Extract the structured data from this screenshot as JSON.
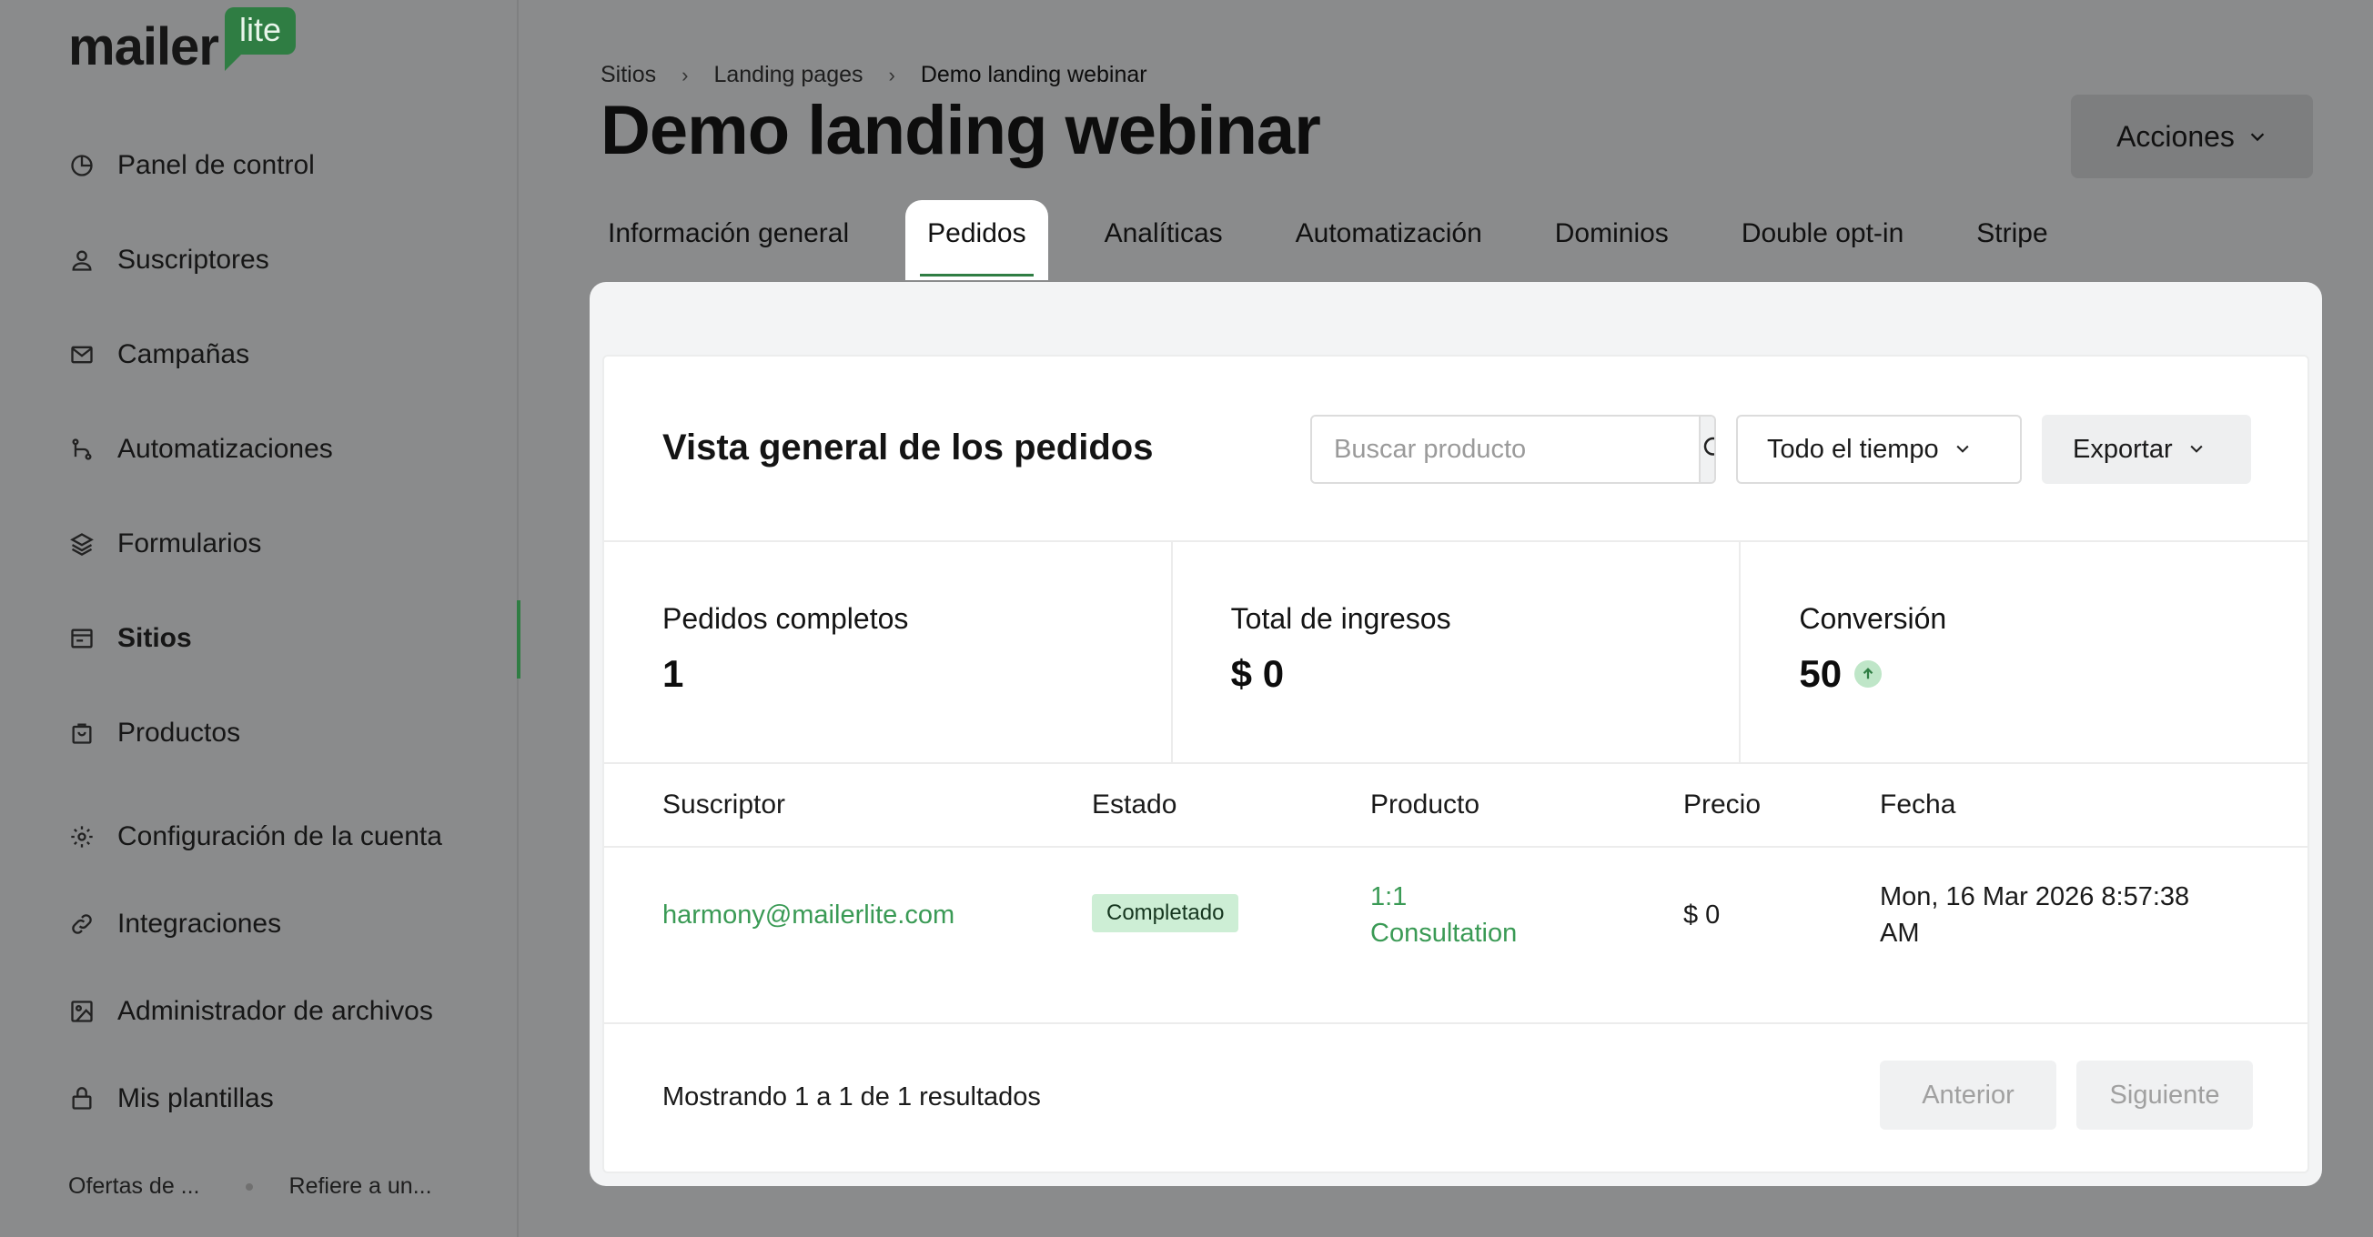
{
  "app": {
    "logo_word": "mailer",
    "logo_badge": "lite"
  },
  "sidebar": {
    "items": [
      {
        "label": "Panel de control",
        "icon": "clock-icon"
      },
      {
        "label": "Suscriptores",
        "icon": "user-icon"
      },
      {
        "label": "Campañas",
        "icon": "mail-icon"
      },
      {
        "label": "Automatizaciones",
        "icon": "workflow-icon"
      },
      {
        "label": "Formularios",
        "icon": "layers-icon"
      },
      {
        "label": "Sitios",
        "icon": "browser-icon",
        "active": true
      },
      {
        "label": "Productos",
        "icon": "bag-icon"
      }
    ],
    "secondary": [
      {
        "label": "Configuración de la cuenta",
        "icon": "gear-icon"
      },
      {
        "label": "Integraciones",
        "icon": "link-icon"
      },
      {
        "label": "Administrador de archivos",
        "icon": "image-icon"
      },
      {
        "label": "Mis plantillas",
        "icon": "template-icon"
      }
    ],
    "footer": {
      "left": "Ofertas de ...",
      "right": "Refiere a un..."
    }
  },
  "breadcrumb": {
    "items": [
      "Sitios",
      "Landing pages"
    ],
    "current": "Demo landing webinar"
  },
  "page": {
    "title": "Demo landing webinar",
    "actions_label": "Acciones"
  },
  "tabs": [
    {
      "label": "Información general"
    },
    {
      "label": "Pedidos",
      "active": true
    },
    {
      "label": "Analíticas"
    },
    {
      "label": "Automatización"
    },
    {
      "label": "Dominios"
    },
    {
      "label": "Double opt-in"
    },
    {
      "label": "Stripe"
    }
  ],
  "orders": {
    "title": "Vista general de los pedidos",
    "search": {
      "placeholder": "Buscar producto",
      "value": ""
    },
    "period": "Todo el tiempo",
    "export_label": "Exportar",
    "stats": [
      {
        "label": "Pedidos completos",
        "value": "1"
      },
      {
        "label": "Total de ingresos",
        "value": "$ 0"
      },
      {
        "label": "Conversión",
        "value": "50",
        "trend": "up"
      }
    ],
    "columns": [
      "Suscriptor",
      "Estado",
      "Producto",
      "Precio",
      "Fecha"
    ],
    "rows": [
      {
        "subscriber": "harmony@mailerlite.com",
        "status": "Completado",
        "product_line1": "1:1",
        "product_line2": "Consultation",
        "price": "$ 0",
        "date_line1": "Mon, 16 Mar 2026 8:57:38",
        "date_line2": "AM"
      }
    ],
    "pagination": {
      "text": "Mostrando 1 a 1 de 1 resultados",
      "prev_label": "Anterior",
      "next_label": "Siguiente"
    }
  },
  "colors": {
    "brand": "#2f7d43",
    "link": "#3a9a55",
    "badge_bg": "#cdeed5"
  }
}
